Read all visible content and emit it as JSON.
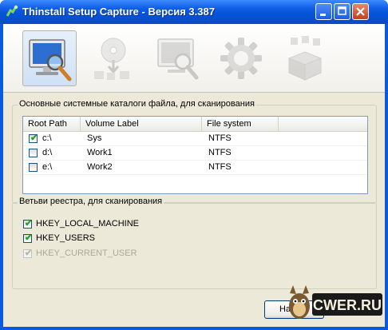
{
  "window": {
    "title": "Thinstall Setup Capture - Версия 3.387"
  },
  "steps": [
    {
      "name": "scan",
      "icon": "monitor-magnifier-icon",
      "active": true
    },
    {
      "name": "install",
      "icon": "disc-install-icon",
      "active": false
    },
    {
      "name": "rescan",
      "icon": "monitor-search-icon",
      "active": false
    },
    {
      "name": "configure",
      "icon": "gear-icon",
      "active": false
    },
    {
      "name": "package",
      "icon": "package-icon",
      "active": false
    }
  ],
  "folders_group": {
    "label": "Основные системные каталоги файла, для сканирования",
    "columns": [
      "Root Path",
      "Volume Label",
      "File system"
    ],
    "rows": [
      {
        "checked": true,
        "path": "c:\\",
        "label": "Sys",
        "fs": "NTFS"
      },
      {
        "checked": false,
        "path": "d:\\",
        "label": "Work1",
        "fs": "NTFS"
      },
      {
        "checked": false,
        "path": "e:\\",
        "label": "Work2",
        "fs": "NTFS"
      }
    ]
  },
  "registry_group": {
    "label": "Ветьви реестра, для сканирования",
    "items": [
      {
        "label": "HKEY_LOCAL_MACHINE",
        "checked": true,
        "disabled": false
      },
      {
        "label": "HKEY_USERS",
        "checked": true,
        "disabled": false
      },
      {
        "label": "HKEY_CURRENT_USER",
        "checked": true,
        "disabled": true
      }
    ]
  },
  "footer": {
    "next_label": "На",
    "watermark": "CWER.RU"
  }
}
